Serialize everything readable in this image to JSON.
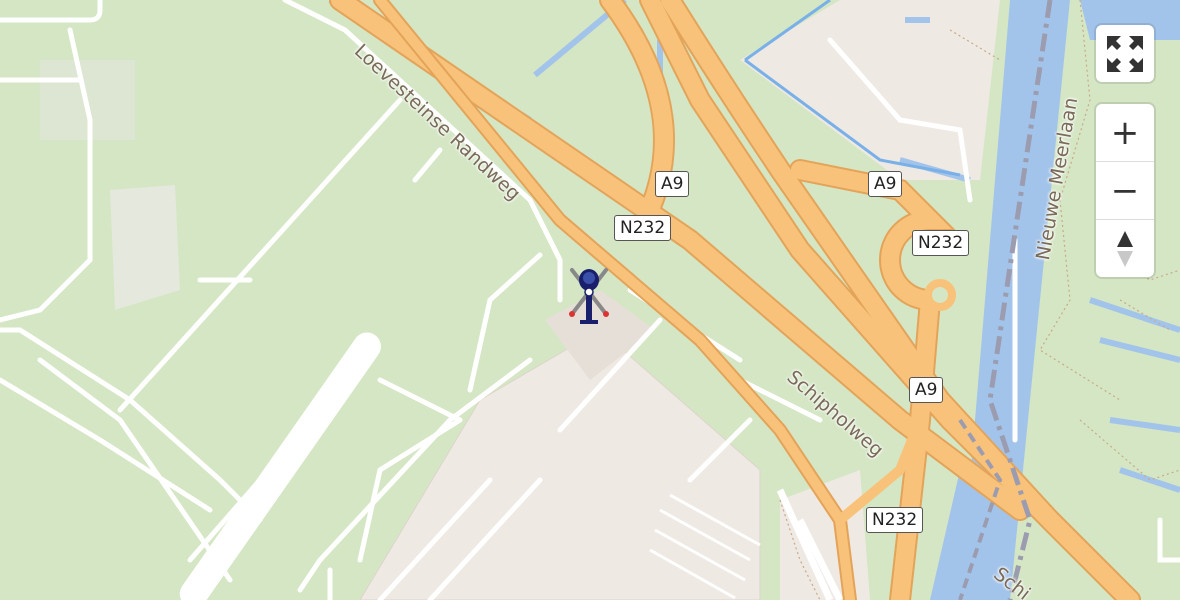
{
  "map": {
    "route_shields": [
      {
        "id": "a9-north",
        "label": "A9"
      },
      {
        "id": "a9-ring",
        "label": "A9"
      },
      {
        "id": "n232-north",
        "label": "N232"
      },
      {
        "id": "n232-ring",
        "label": "N232"
      },
      {
        "id": "a9-south",
        "label": "A9"
      },
      {
        "id": "n232-south",
        "label": "N232"
      }
    ],
    "street_labels": {
      "loevesteinse": "Loevesteinse Randweg",
      "schipholweg": "Schipholweg",
      "nieuwe_meerlaan": "Nieuwe Meerlaan",
      "schip_partial": "Schi"
    },
    "marker": {
      "icon": "helicopter-icon"
    },
    "colors": {
      "grass": "#d4e6c4",
      "motorway": "#f9c27a",
      "motorway_casing": "#e3a45a",
      "water": "#a3c4ea",
      "apron": "#efe9e3",
      "road": "#ffffff",
      "rail": "#9c9cb0"
    }
  },
  "controls": {
    "fullscreen_icon": "fullscreen-icon",
    "zoom_in_label": "+",
    "zoom_out_label": "−",
    "compass_icon": "compass-icon"
  }
}
